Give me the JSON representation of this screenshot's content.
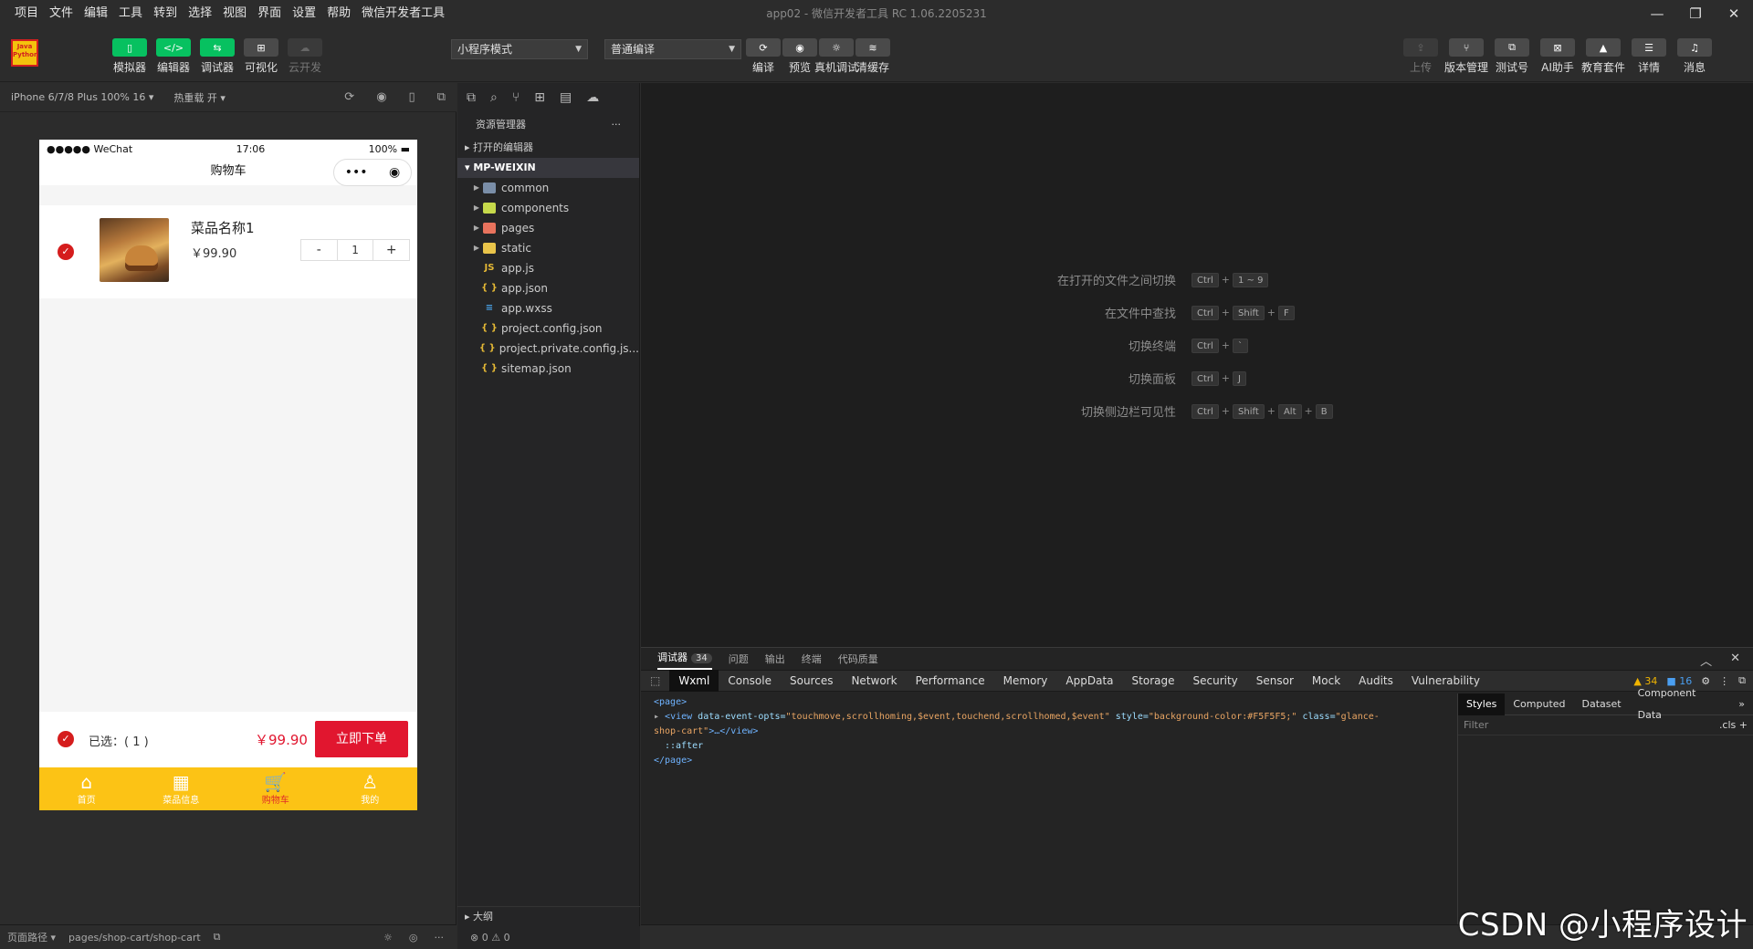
{
  "window": {
    "title": "app02 - 微信开发者工具 RC 1.06.2205231",
    "menus": [
      "项目",
      "文件",
      "编辑",
      "工具",
      "转到",
      "选择",
      "视图",
      "界面",
      "设置",
      "帮助",
      "微信开发者工具"
    ],
    "controls": {
      "minimize": "—",
      "restore": "❐",
      "close": "✕"
    }
  },
  "toolbar": {
    "logo_text": "Java Python",
    "left_buttons": [
      {
        "label": "模拟器",
        "icon": "phone-icon"
      },
      {
        "label": "编辑器",
        "icon": "code-icon"
      },
      {
        "label": "调试器",
        "icon": "debug-icon"
      },
      {
        "label": "可视化",
        "icon": "layout-icon"
      },
      {
        "label": "云开发",
        "icon": "cloud-icon"
      }
    ],
    "mode_select": "小程序模式",
    "compile_select": "普通编译",
    "mid_buttons": [
      {
        "label": "编译",
        "icon": "refresh-icon"
      },
      {
        "label": "预览",
        "icon": "eye-icon"
      },
      {
        "label": "真机调试",
        "icon": "bug-icon"
      },
      {
        "label": "清缓存",
        "icon": "layers-icon"
      }
    ],
    "right_buttons": [
      {
        "label": "上传",
        "icon": "upload-icon"
      },
      {
        "label": "版本管理",
        "icon": "branch-icon"
      },
      {
        "label": "测试号",
        "icon": "test-icon"
      },
      {
        "label": "AI助手",
        "icon": "ai-icon"
      },
      {
        "label": "教育套件",
        "icon": "education-icon"
      },
      {
        "label": "详情",
        "icon": "menu-icon"
      },
      {
        "label": "消息",
        "icon": "bell-icon"
      }
    ]
  },
  "simulator": {
    "device": "iPhone 6/7/8 Plus 100% 16 ▾",
    "hotreload": "热重载 开 ▾",
    "status": {
      "carrier": "●●●●● WeChat",
      "time": "17:06",
      "battery": "100%"
    },
    "nav_title": "购物车",
    "item": {
      "name": "菜品名称1",
      "price": "￥99.90",
      "qty": "1",
      "minus": "-",
      "plus": "+"
    },
    "bottom": {
      "selected": "已选：( 1 )",
      "total": "￥99.90",
      "order_btn": "立即下单"
    },
    "tabs": [
      {
        "label": "首页",
        "icon": "⌂"
      },
      {
        "label": "菜品信息",
        "icon": "▦"
      },
      {
        "label": "购物车",
        "icon": "🛒"
      },
      {
        "label": "我的",
        "icon": "♙"
      }
    ],
    "footer": {
      "path_label": "页面路径 ▾",
      "path": "pages/shop-cart/shop-cart"
    }
  },
  "explorer": {
    "header": "资源管理器",
    "more": "···",
    "open_editors": "打开的编辑器",
    "root": "MP-WEIXIN",
    "files": [
      {
        "name": "common",
        "type": "folder",
        "color": "#7a8ea8"
      },
      {
        "name": "components",
        "type": "folder",
        "color": "#c6d94b"
      },
      {
        "name": "pages",
        "type": "folder",
        "color": "#e8735d"
      },
      {
        "name": "static",
        "type": "folder",
        "color": "#e9c44a"
      },
      {
        "name": "app.js",
        "type": "js",
        "icon": "JS"
      },
      {
        "name": "app.json",
        "type": "json",
        "icon": "{ }"
      },
      {
        "name": "app.wxss",
        "type": "css",
        "icon": "≡"
      },
      {
        "name": "project.config.json",
        "type": "json",
        "icon": "{ }"
      },
      {
        "name": "project.private.config.js...",
        "type": "json",
        "icon": "{ }"
      },
      {
        "name": "sitemap.json",
        "type": "json",
        "icon": "{ }"
      }
    ],
    "outline": "大纲",
    "problems": "⊗ 0 ⚠ 0"
  },
  "editor": {
    "hints": [
      {
        "text": "在打开的文件之间切换",
        "keys": [
          "Ctrl",
          "1 ~ 9"
        ]
      },
      {
        "text": "在文件中查找",
        "keys": [
          "Ctrl",
          "Shift",
          "F"
        ]
      },
      {
        "text": "切换终端",
        "keys": [
          "Ctrl",
          "`"
        ]
      },
      {
        "text": "切换面板",
        "keys": [
          "Ctrl",
          "J"
        ]
      },
      {
        "text": "切换侧边栏可见性",
        "keys": [
          "Ctrl",
          "Shift",
          "Alt",
          "B"
        ]
      }
    ]
  },
  "devtools": {
    "top_tabs": [
      {
        "label": "调试器",
        "badge": "34"
      },
      {
        "label": "问题"
      },
      {
        "label": "输出"
      },
      {
        "label": "终端"
      },
      {
        "label": "代码质量"
      }
    ],
    "panel_tabs": [
      "Wxml",
      "Console",
      "Sources",
      "Network",
      "Performance",
      "Memory",
      "AppData",
      "Storage",
      "Security",
      "Sensor",
      "Mock",
      "Audits",
      "Vulnerability"
    ],
    "warnings": "▲ 34",
    "messages": "■ 16",
    "code": {
      "line1": "<page>",
      "line2_tag": "<view",
      "line2_attr1": " data-event-opts=",
      "line2_val1": "\"touchmove,scrollhoming,$event,touchend,scrollhomed,$event\"",
      "line2_attr2": " style=",
      "line2_val2": "\"background-color:#F5F5F5;\"",
      "line2_attr3": " class=",
      "line2_val3": "\"glance-",
      "line3_val": "shop-cart\"",
      "line3_rest": ">…</view>",
      "line4": "::after",
      "line5": "</page>"
    },
    "style_tabs": [
      "Styles",
      "Computed",
      "Dataset",
      "Component Data"
    ],
    "filter_placeholder": "Filter",
    "cls": ".cls"
  },
  "watermark": "CSDN @小程序设计"
}
